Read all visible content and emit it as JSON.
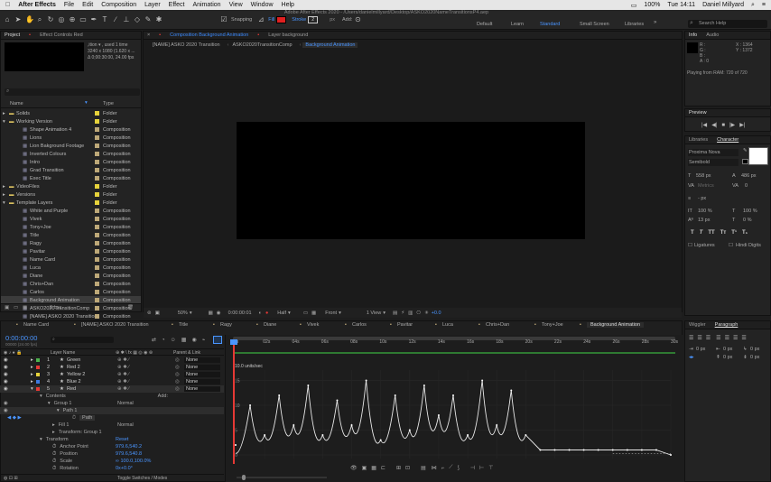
{
  "mac_menu": {
    "app": "After Effects",
    "items": [
      "File",
      "Edit",
      "Composition",
      "Layer",
      "Effect",
      "Animation",
      "View",
      "Window",
      "Help"
    ],
    "battery": "100%",
    "clock": "Tue 14:11",
    "user": "Daniel Millyard"
  },
  "window_title": "Adobe After Effects 2020 - /Users/danielmillyard/Desktop/ASKO2020NameTransitionsP4.aep",
  "toolbar": {
    "snapping": "Snapping",
    "fill": "Fill",
    "stroke": "Stroke",
    "stroke_value": "2",
    "stroke_unit": "px",
    "add": "Add:",
    "fill_color": "#e02020"
  },
  "workspaces": [
    "Default",
    "Learn",
    "Standard",
    "Small Screen",
    "Libraries"
  ],
  "active_workspace": "Standard",
  "search_help": "Search Help",
  "project_panel": {
    "tabs": [
      "Project",
      "Effect Controls Red"
    ],
    "info_lines": [
      ",ition ▾ , used 1 time",
      "3240 x 1080 (1.620 x ...",
      "Δ 0;00:30:00, 24.00 fps"
    ],
    "col_name": "Name",
    "col_type": "Type",
    "rows": [
      {
        "name": "Solids",
        "type": "Folder",
        "indent": 0,
        "folder": true,
        "color": "#e6d23b"
      },
      {
        "name": "Working Version",
        "type": "Folder",
        "indent": 0,
        "folder": true,
        "color": "#e6d23b",
        "open": true
      },
      {
        "name": "Shape Animation 4",
        "type": "Composition",
        "indent": 1,
        "color": "#bda878"
      },
      {
        "name": "Lions",
        "type": "Composition",
        "indent": 1,
        "color": "#bda878"
      },
      {
        "name": "Lion Bakground Footage",
        "type": "Composition",
        "indent": 1,
        "color": "#bda878"
      },
      {
        "name": "Inverted Colours",
        "type": "Composition",
        "indent": 1,
        "color": "#bda878"
      },
      {
        "name": "Intro",
        "type": "Composition",
        "indent": 1,
        "color": "#bda878"
      },
      {
        "name": "Grad Transition",
        "type": "Composition",
        "indent": 1,
        "color": "#bda878"
      },
      {
        "name": "Exec Title",
        "type": "Composition",
        "indent": 1,
        "color": "#bda878"
      },
      {
        "name": "VideoFiles",
        "type": "Folder",
        "indent": 0,
        "folder": true,
        "color": "#e6d23b"
      },
      {
        "name": "Versions",
        "type": "Folder",
        "indent": 0,
        "folder": true,
        "color": "#e6d23b"
      },
      {
        "name": "Template Layers",
        "type": "Folder",
        "indent": 0,
        "folder": true,
        "color": "#e6d23b",
        "open": true
      },
      {
        "name": "White and Purple",
        "type": "Composition",
        "indent": 1,
        "color": "#bda878"
      },
      {
        "name": "Vivek",
        "type": "Composition",
        "indent": 1,
        "color": "#bda878"
      },
      {
        "name": "Tony+Joe",
        "type": "Composition",
        "indent": 1,
        "color": "#bda878"
      },
      {
        "name": "Title",
        "type": "Composition",
        "indent": 1,
        "color": "#bda878"
      },
      {
        "name": "Ragy",
        "type": "Composition",
        "indent": 1,
        "color": "#bda878"
      },
      {
        "name": "Pavitar",
        "type": "Composition",
        "indent": 1,
        "color": "#bda878"
      },
      {
        "name": "Name Card",
        "type": "Composition",
        "indent": 1,
        "color": "#bda878"
      },
      {
        "name": "Luca",
        "type": "Composition",
        "indent": 1,
        "color": "#bda878"
      },
      {
        "name": "Diane",
        "type": "Composition",
        "indent": 1,
        "color": "#bda878"
      },
      {
        "name": "Chris+Dan",
        "type": "Composition",
        "indent": 1,
        "color": "#bda878"
      },
      {
        "name": "Carlos",
        "type": "Composition",
        "indent": 1,
        "color": "#bda878"
      },
      {
        "name": "Background Animation",
        "type": "Composition",
        "indent": 1,
        "color": "#bda878",
        "selected": true
      },
      {
        "name": "ASKO2020TransitionComp",
        "type": "Composition",
        "indent": 1,
        "color": "#bda878"
      },
      {
        "name": "[NAME] ASKO 2020 Transition",
        "type": "Composition",
        "indent": 1,
        "color": "#bda878"
      }
    ],
    "bit_depth": "8 bpc"
  },
  "comp_panel": {
    "tabs": [
      "Composition Background Animation",
      "Layer background"
    ],
    "breadcrumbs": [
      "[NAME] ASKO 2020 Transition",
      "ASKO2020TransitionComp",
      "Background Animation"
    ],
    "zoom": "50%",
    "timecode": "0:00:00:01",
    "resolution": "Half",
    "view": "Front",
    "views": "1 View",
    "exposure": "+0.0"
  },
  "info_panel": {
    "tabs": [
      "Info",
      "Audio"
    ],
    "r": "R :",
    "g": "G :",
    "b": "B :",
    "a": "A :  0",
    "x": "X : 1364",
    "y": "Y : 1372",
    "status": "Playing from RAM: 720 of 720"
  },
  "preview_panel": {
    "title": "Preview"
  },
  "character_panel": {
    "tabs": [
      "Libraries",
      "Character"
    ],
    "font": "Proxima Nova",
    "style": "Semibold",
    "size": "558 px",
    "leading": "486 px",
    "kerning": "Metrics",
    "tracking": "0",
    "stroke_w": "- px",
    "vscale": "100 %",
    "hscale": "100 %",
    "baseline": "13 px",
    "tsume": "0 %",
    "ligatures": "Ligatures",
    "hindi": "Hindi Digits"
  },
  "timeline": {
    "tabs": [
      "Name Card",
      "[NAME] ASKO 2020 Transition",
      "Title",
      "Ragy",
      "Diane",
      "Vivek",
      "Carlos",
      "Pavitar",
      "Luca",
      "Chris+Dan",
      "Tony+Joe",
      "Background Animation"
    ],
    "active_tab": "Background Animation",
    "timecode": "0:00:00:00",
    "timecode_sub": "00000 (24.00 fps)",
    "col_layer_name": "Layer Name",
    "col_parent": "Parent & Link",
    "layers": [
      {
        "num": "1",
        "name": "Green",
        "color": "#4db34d",
        "parent": "None"
      },
      {
        "num": "2",
        "name": "Red 2",
        "color": "#e53935",
        "parent": "None"
      },
      {
        "num": "3",
        "name": "Yellow 2",
        "color": "#e6d23b",
        "parent": "None"
      },
      {
        "num": "4",
        "name": "Blue 2",
        "color": "#3d7ae0",
        "parent": "None"
      },
      {
        "num": "5",
        "name": "Red",
        "color": "#e53935",
        "parent": "None"
      }
    ],
    "props": {
      "contents": "Contents",
      "add": "Add:",
      "group1": "Group 1",
      "group1_mode": "Normal",
      "path1": "Path 1",
      "path": "Path",
      "fill1": "Fill 1",
      "fill1_mode": "Normal",
      "transform_group": "Transform: Group 1",
      "transform": "Transform",
      "reset": "Reset",
      "anchor": "Anchor Point",
      "anchor_val": "979.6,540.2",
      "position": "Position",
      "position_val": "979.6,540.8",
      "scale": "Scale",
      "scale_val": "∞ 100.0,100.0%",
      "rotation": "Rotation",
      "rotation_val": "0x+0.0°"
    },
    "toggle_label": "Toggle Switches / Modes",
    "ruler": [
      "0s",
      "02s",
      "04s",
      "06s",
      "08s",
      "10s",
      "12s",
      "14s",
      "16s",
      "18s",
      "20s",
      "22s",
      "24s",
      "26s",
      "28s",
      "30s"
    ],
    "graph_unit": "10.0 units/sec",
    "graph_ticks": [
      "15",
      "10",
      "5",
      "0"
    ]
  },
  "wiggler_panel": {
    "tabs": [
      "Wiggler",
      "Paragraph"
    ],
    "indent_l": "0 px",
    "indent_r": "0 px",
    "indent_f": "0 px",
    "space_b": "0 px",
    "space_a": "0 px"
  },
  "chart_data": {
    "type": "line",
    "title": "",
    "xlabel": "",
    "ylabel": "10.0 units/sec",
    "x": [
      0,
      1,
      2,
      3,
      4,
      5,
      6,
      7,
      8,
      9,
      10,
      11,
      12,
      13,
      14,
      15,
      16,
      17,
      18,
      19,
      20,
      21,
      22,
      23,
      24,
      25,
      26,
      27,
      28,
      29,
      30
    ],
    "series": [
      {
        "name": "",
        "values": [
          2,
          10,
          4,
          12,
          6,
          14,
          4,
          11,
          6,
          15,
          3,
          12,
          5,
          14,
          8,
          12,
          4,
          15,
          6,
          13,
          4,
          1,
          1,
          1,
          1,
          1,
          1,
          1,
          1,
          1,
          0
        ]
      }
    ]
  }
}
